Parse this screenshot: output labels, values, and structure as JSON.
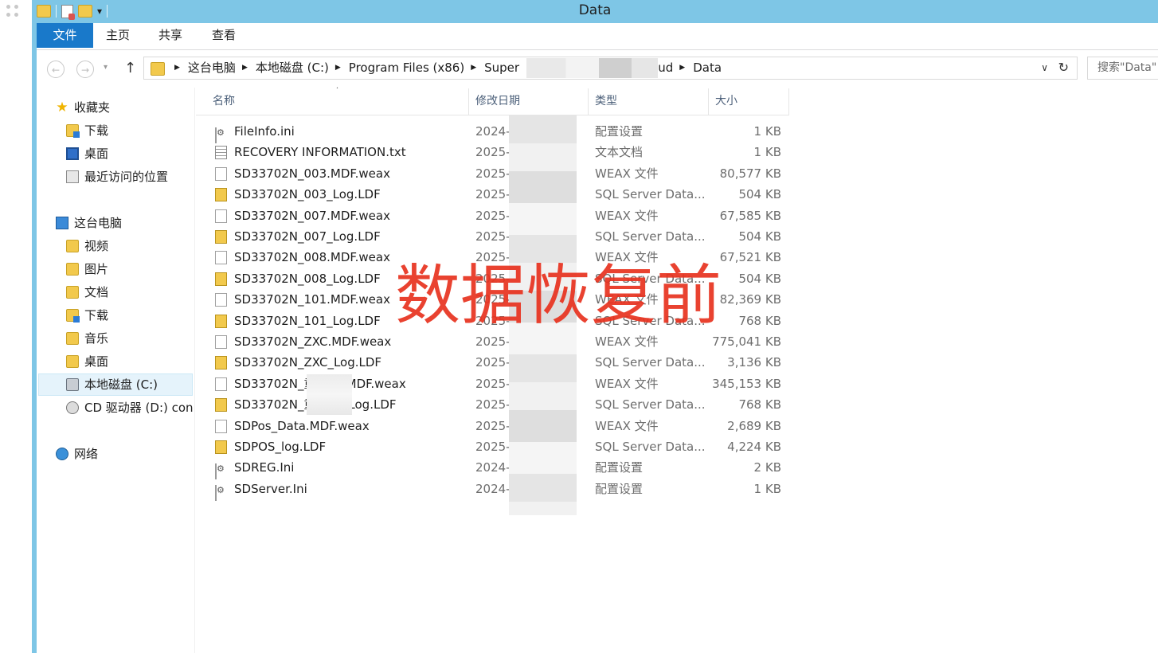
{
  "window": {
    "title": "Data"
  },
  "ribbon": {
    "tabs": [
      "文件",
      "主页",
      "共享",
      "查看"
    ]
  },
  "address": {
    "crumbs": [
      "这台电脑",
      "本地磁盘 (C:)",
      "Program Files (x86)",
      "Super",
      "oud",
      "Data"
    ],
    "search_placeholder": "搜索\"Data\""
  },
  "navigation": {
    "favorites_label": "收藏夹",
    "favorites": [
      "下载",
      "桌面",
      "最近访问的位置"
    ],
    "pc_label": "这台电脑",
    "pc_items": [
      "视频",
      "图片",
      "文档",
      "下载",
      "音乐",
      "桌面",
      "本地磁盘 (C:)",
      "CD 驱动器 (D:) con"
    ],
    "network_label": "网络"
  },
  "file_list": {
    "columns": [
      "名称",
      "修改日期",
      "类型",
      "大小"
    ],
    "rows": [
      {
        "name": "FileInfo.ini",
        "date": "2024-",
        "type": "配置设置",
        "size": "1 KB",
        "icon": "ini-file-icon"
      },
      {
        "name": "RECOVERY INFORMATION.txt",
        "date": "2025-",
        "type": "文本文档",
        "size": "1 KB",
        "icon": "text-file-icon"
      },
      {
        "name": "SD33702N_003.MDF.weax",
        "date": "2025-",
        "type": "WEAX 文件",
        "size": "80,577 KB",
        "icon": "blank-file-icon"
      },
      {
        "name": "SD33702N_003_Log.LDF",
        "date": "2025-",
        "type": "SQL Server Data...",
        "size": "504 KB",
        "icon": "sql-data-file-icon"
      },
      {
        "name": "SD33702N_007.MDF.weax",
        "date": "2025-",
        "type": "WEAX 文件",
        "size": "67,585 KB",
        "icon": "blank-file-icon"
      },
      {
        "name": "SD33702N_007_Log.LDF",
        "date": "2025-",
        "type": "SQL Server Data...",
        "size": "504 KB",
        "icon": "sql-data-file-icon"
      },
      {
        "name": "SD33702N_008.MDF.weax",
        "date": "2025-",
        "type": "WEAX 文件",
        "size": "67,521 KB",
        "icon": "blank-file-icon"
      },
      {
        "name": "SD33702N_008_Log.LDF",
        "date": "2025-",
        "type": "SQL Server Data...",
        "size": "504 KB",
        "icon": "sql-data-file-icon"
      },
      {
        "name": "SD33702N_101.MDF.weax",
        "date": "2025-",
        "type": "WEAX 文件",
        "size": "82,369 KB",
        "icon": "blank-file-icon"
      },
      {
        "name": "SD33702N_101_Log.LDF",
        "date": "2025-",
        "type": "SQL Server Data...",
        "size": "768 KB",
        "icon": "sql-data-file-icon"
      },
      {
        "name": "SD33702N_ZXC.MDF.weax",
        "date": "2025-",
        "type": "WEAX 文件",
        "size": "775,041 KB",
        "icon": "blank-file-icon"
      },
      {
        "name": "SD33702N_ZXC_Log.LDF",
        "date": "2025-",
        "type": "SQL Server Data...",
        "size": "3,136 KB",
        "icon": "sql-data-file-icon"
      },
      {
        "name": "SD33702N_重       001.MDF.weax",
        "date": "2025-",
        "type": "WEAX 文件",
        "size": "345,153 KB",
        "icon": "blank-file-icon"
      },
      {
        "name": "SD33702N_重       001_Log.LDF",
        "date": "2025-",
        "type": "SQL Server Data...",
        "size": "768 KB",
        "icon": "sql-data-file-icon"
      },
      {
        "name": "SDPos_Data.MDF.weax",
        "date": "2025-",
        "type": "WEAX 文件",
        "size": "2,689 KB",
        "icon": "blank-file-icon"
      },
      {
        "name": "SDPOS_log.LDF",
        "date": "2025-",
        "type": "SQL Server Data...",
        "size": "4,224 KB",
        "icon": "sql-data-file-icon"
      },
      {
        "name": "SDREG.Ini",
        "date": "2024-",
        "type": "配置设置",
        "size": "2 KB",
        "icon": "ini-file-icon"
      },
      {
        "name": "SDServer.Ini",
        "date": "2024-",
        "type": "配置设置",
        "size": "1 KB",
        "icon": "ini-file-icon"
      }
    ]
  },
  "overlay": {
    "watermark": "数据恢复前"
  }
}
